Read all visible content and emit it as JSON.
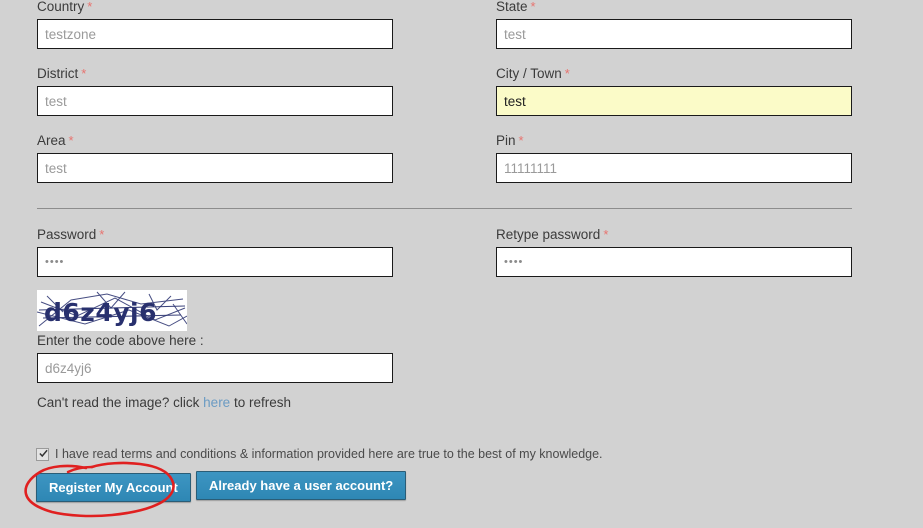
{
  "form": {
    "address_fields": [
      {
        "label": "Country",
        "required": true,
        "value": "testzone",
        "state": "placeholder"
      },
      {
        "label": "State",
        "required": true,
        "value": "test",
        "state": "placeholder"
      },
      {
        "label": "District",
        "required": true,
        "value": "test",
        "state": "placeholder"
      },
      {
        "label": "City / Town",
        "required": true,
        "value": "test",
        "state": "autofilled"
      },
      {
        "label": "Area",
        "required": true,
        "value": "test",
        "state": "placeholder"
      },
      {
        "label": "Pin",
        "required": true,
        "value": "11111111",
        "state": "placeholder"
      }
    ],
    "password_fields": [
      {
        "label": "Password",
        "required": true,
        "value": "••••"
      },
      {
        "label": "Retype password",
        "required": true,
        "value": "••••"
      }
    ],
    "required_marker": "*"
  },
  "captcha": {
    "code_text": "d6z4yj6",
    "input_label": "Enter the code above here :",
    "input_value": "d6z4yj6",
    "refresh_prefix": "Can't read the image? click ",
    "refresh_link": "here",
    "refresh_suffix": " to refresh"
  },
  "terms": {
    "label": "I have read terms and conditions & information provided here are true to the best of my knowledge.",
    "checked": true
  },
  "actions": {
    "register_label": "Register My Account",
    "signin_label": "Already have a user account?"
  },
  "colors": {
    "page_background": "#d2d2d2",
    "button_blue": "#3389b8",
    "autofill_yellow": "#fbfbc8",
    "required_red": "#e8736f",
    "link_blue": "#6b9bc3",
    "annotation_red": "#e02020",
    "captcha_ink": "#28306e"
  },
  "annotation": {
    "shape": "hand-drawn-ellipse",
    "target": "register-my-account-button"
  }
}
